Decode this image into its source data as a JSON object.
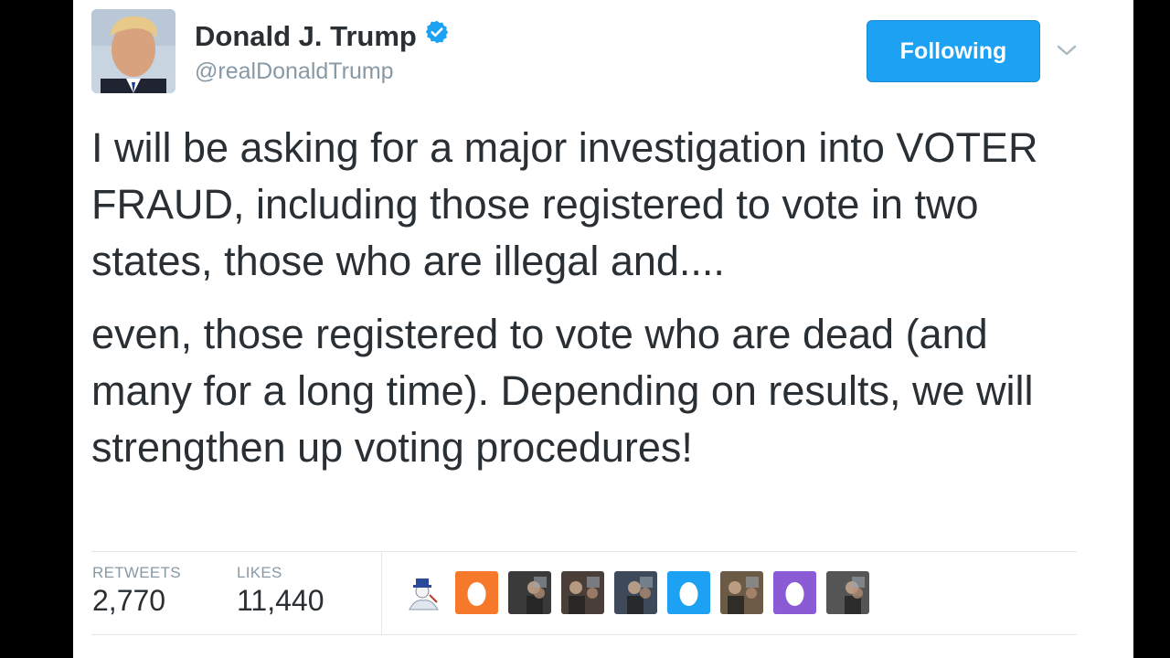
{
  "user": {
    "name": "Donald J. Trump",
    "handle": "@realDonaldTrump",
    "verified": true
  },
  "follow_button": {
    "label": "Following"
  },
  "tweet": {
    "paragraphs": [
      "I will be asking for a major investigation into VOTER FRAUD, including those registered to vote in two states, those who are illegal and....",
      "even, those registered to vote who are dead (and many for a long time). Depending on results, we will strengthen up voting procedures!"
    ]
  },
  "stats": {
    "retweets_label": "RETWEETS",
    "retweets_value": "2,770",
    "likes_label": "LIKES",
    "likes_value": "11,440"
  },
  "likers": [
    {
      "type": "cartoon-figure"
    },
    {
      "type": "default-egg",
      "color": "#f5782b"
    },
    {
      "type": "photo",
      "color": "#3a3a3a"
    },
    {
      "type": "photo",
      "color": "#4a3f38"
    },
    {
      "type": "photo",
      "color": "#3e4a5a"
    },
    {
      "type": "default-egg",
      "color": "#1da1f2"
    },
    {
      "type": "photo",
      "color": "#6b5a45"
    },
    {
      "type": "default-egg",
      "color": "#8b5bd6"
    },
    {
      "type": "photo",
      "color": "#555555"
    }
  ],
  "colors": {
    "accent": "#1da1f2",
    "text": "#292f33",
    "muted": "#8899a6"
  }
}
